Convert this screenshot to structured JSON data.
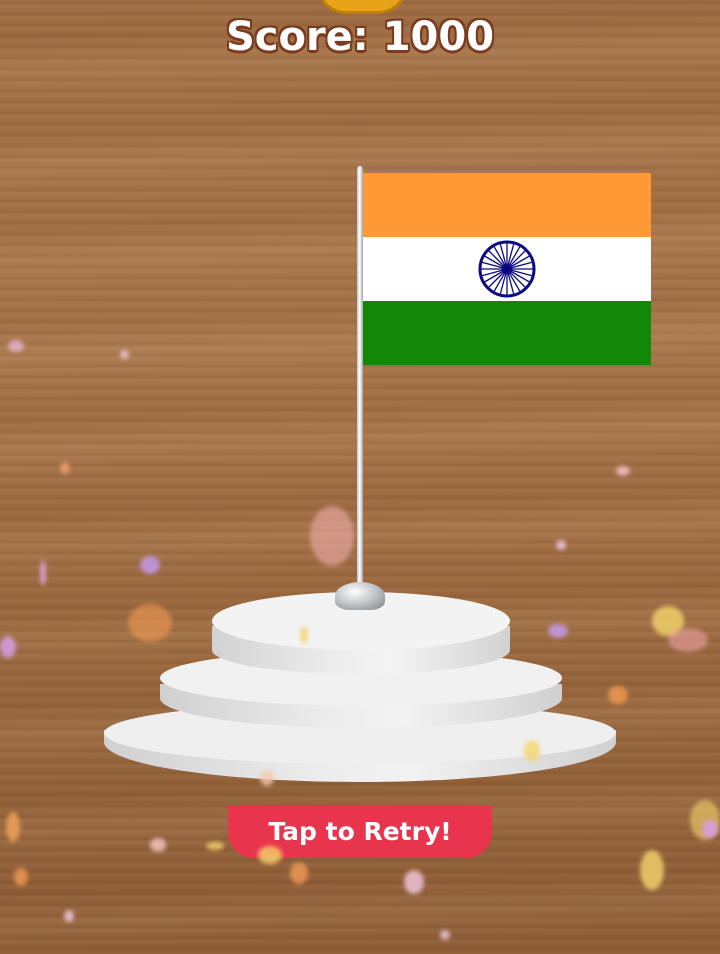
{
  "hud": {
    "score_text": "Score: 1000"
  },
  "flag": {
    "country": "India",
    "colors": {
      "saffron": "#ff9933",
      "white": "#ffffff",
      "green": "#138808",
      "chakra": "#0b0b80"
    }
  },
  "actions": {
    "retry_label": "Tap to Retry!"
  },
  "colors": {
    "wood": "#a06e45",
    "retry_button": "#e8344d",
    "podium": "#efefef"
  }
}
